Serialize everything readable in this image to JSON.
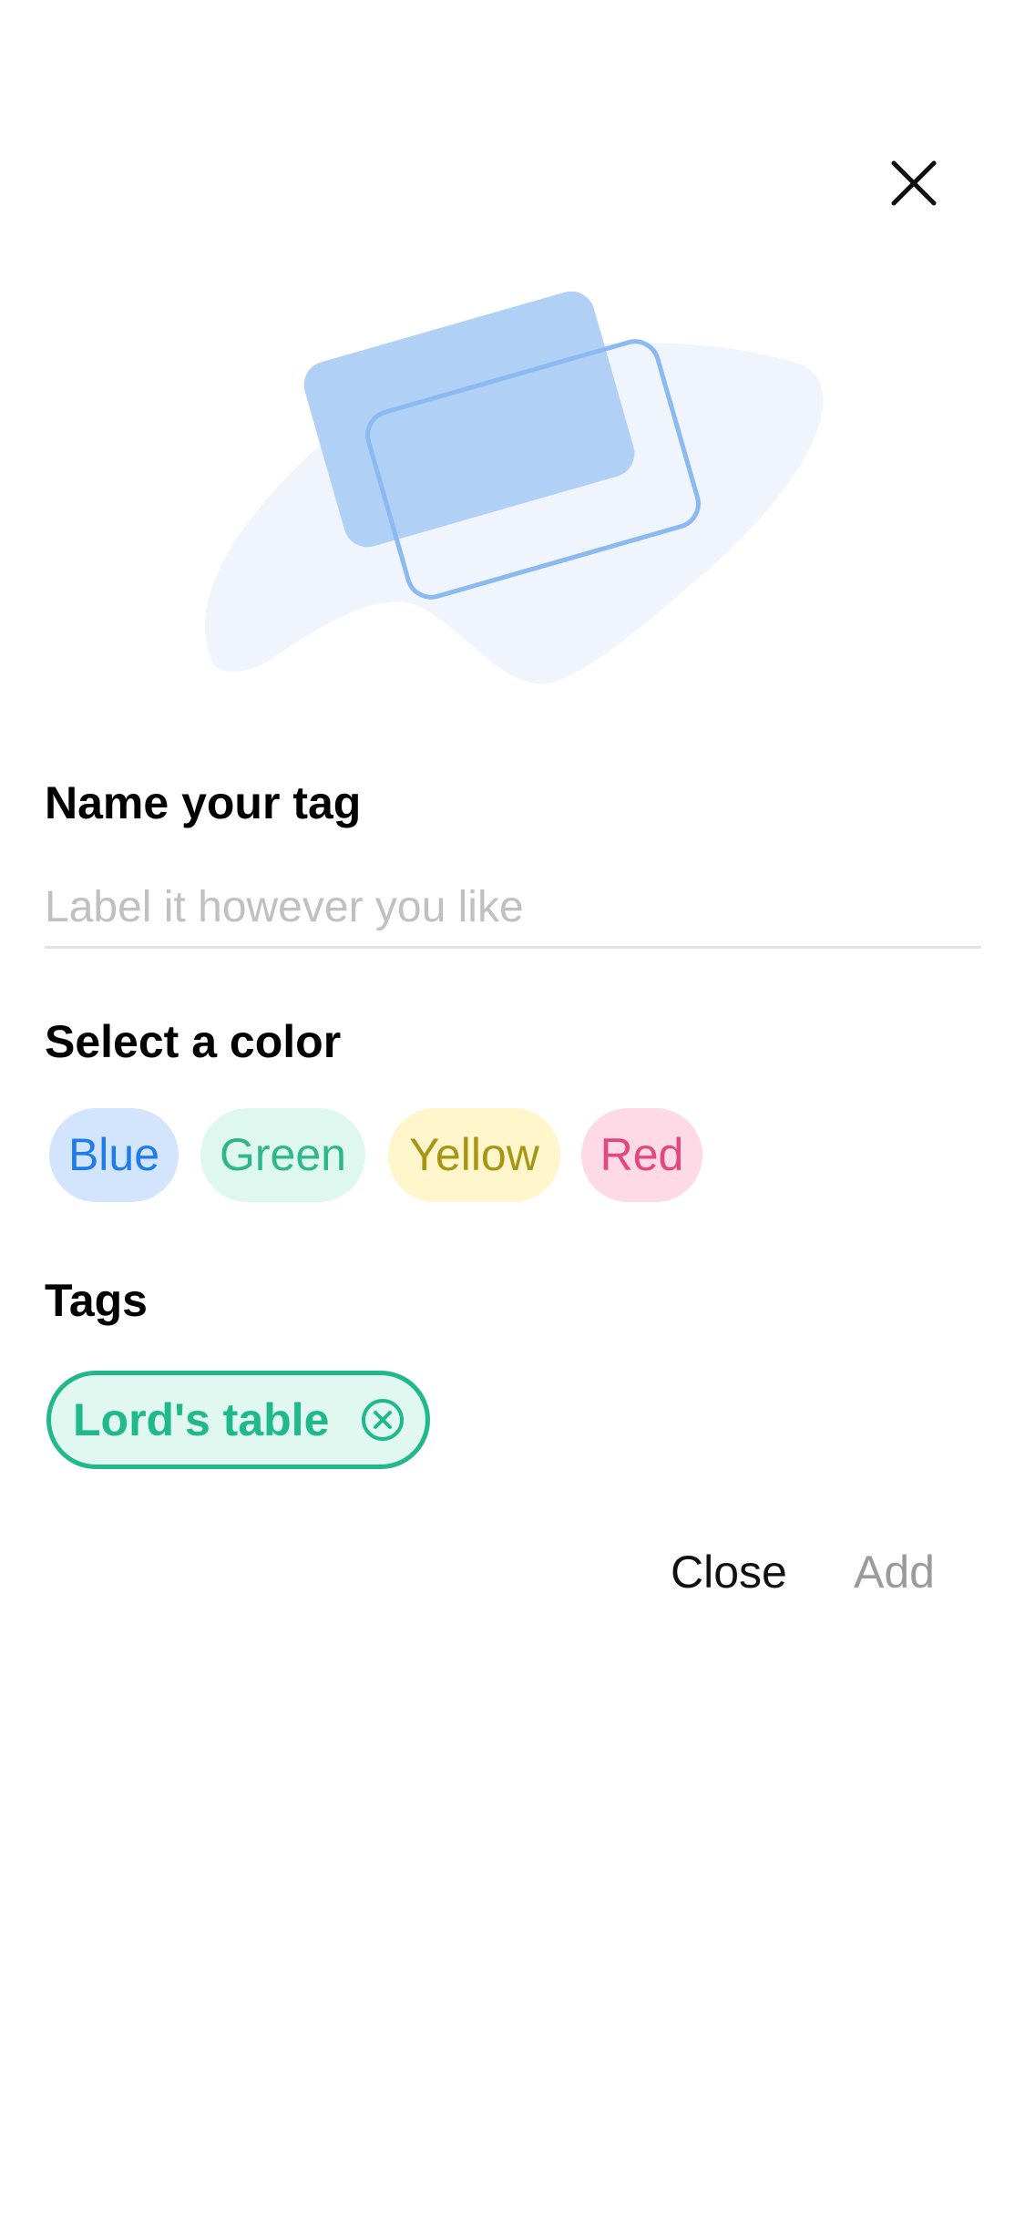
{
  "header": {
    "close_icon": "close-icon"
  },
  "illustration": {
    "icon": "tag-cards-illustration",
    "colors": {
      "blob": "#eff4fd",
      "card_fill": "#b1d0f6",
      "card_outline": "#8bbaf1"
    }
  },
  "name_section": {
    "title": "Name your tag",
    "input_value": "",
    "input_placeholder": "Label it however you like"
  },
  "color_section": {
    "title": "Select a color",
    "options": [
      {
        "label": "Blue",
        "bg": "#d3e5fd",
        "fg": "#1f7ce9"
      },
      {
        "label": "Green",
        "bg": "#dff8ef",
        "fg": "#2fb68a"
      },
      {
        "label": "Yellow",
        "bg": "#fff6cb",
        "fg": "#a89514"
      },
      {
        "label": "Red",
        "bg": "#fddae6",
        "fg": "#e4477e"
      }
    ]
  },
  "tags_section": {
    "title": "Tags",
    "items": [
      {
        "label": "Lord's table",
        "color": "#21b98b",
        "remove_icon": "remove-circle-icon"
      }
    ]
  },
  "actions": {
    "close_label": "Close",
    "add_label": "Add"
  }
}
